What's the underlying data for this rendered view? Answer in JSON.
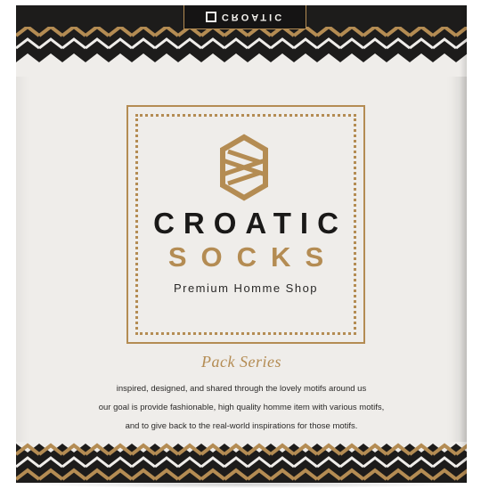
{
  "box": {
    "lid_tab_text": "CROATIC",
    "brand_line1": "CROATIC",
    "brand_line2": "SOCKS",
    "tagline": "Premium Homme Shop",
    "series": "Pack Series",
    "description": [
      "inspired, designed, and shared through the lovely motifs around us",
      "our goal is provide fashionable, high quality homme item with various motifs,",
      "and to give back to the real-world inspirations for those motifs."
    ]
  },
  "colors": {
    "gold": "#b48c53",
    "black": "#1d1c1b",
    "paper": "#efedea"
  },
  "icons": {
    "logo": "hexagon-knot-icon",
    "lid_mark": "square-mark-icon"
  }
}
